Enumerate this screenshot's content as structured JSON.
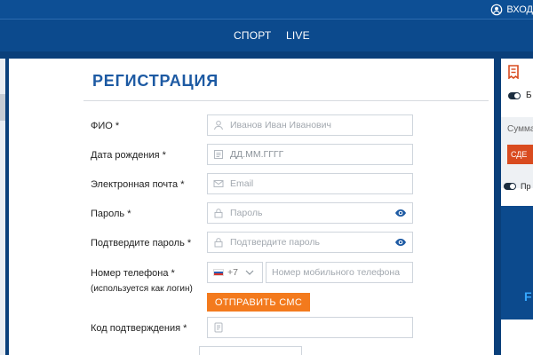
{
  "header": {
    "login_label": "ВХОД",
    "nav": [
      "СПОРТ",
      "LIVE"
    ]
  },
  "form": {
    "title": "РЕГИСТРАЦИЯ",
    "fields": [
      {
        "label": "ФИО *",
        "placeholder": "Иванов Иван Иванович",
        "icon": "user-icon"
      },
      {
        "label": "Дата рождения *",
        "placeholder": "ДД.ММ.ГГГГ",
        "icon": "calendar-icon"
      },
      {
        "label": "Электронная почта *",
        "placeholder": "Email",
        "icon": "envelope-icon"
      },
      {
        "label": "Пароль *",
        "placeholder": "Пароль",
        "icon": "lock-icon"
      },
      {
        "label": "Подтвердите пароль *",
        "placeholder": "Подтвердите пароль",
        "icon": "lock-icon"
      }
    ],
    "phone": {
      "label": "Номер телефона *",
      "sublabel": "(используется как логин)",
      "country_code": "+7",
      "placeholder": "Номер мобильного телефона"
    },
    "send_sms_label": "ОТПРАВИТЬ СМС",
    "code": {
      "label": "Код подтверждения *",
      "icon": "sms-code-icon"
    }
  },
  "sidebar": {
    "toggle1_text": "Б",
    "sum_text": "Сумма",
    "make_button": "СДЕ",
    "toggle2_text": "Пр",
    "banner_letter": "F"
  },
  "colors": {
    "brand_blue": "#0b4a8c",
    "title_blue": "#1d5aa3",
    "accent_orange": "#f37a1d",
    "sidebar_red": "#d94b1f"
  }
}
